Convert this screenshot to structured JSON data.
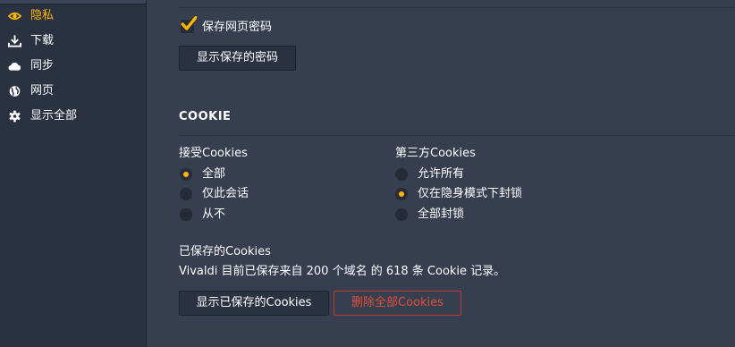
{
  "sidebar": {
    "items": [
      {
        "label": "隐私",
        "icon": "eye-icon",
        "active": true
      },
      {
        "label": "下载",
        "icon": "download-icon",
        "active": false
      },
      {
        "label": "同步",
        "icon": "cloud-icon",
        "active": false
      },
      {
        "label": "网页",
        "icon": "globe-icon",
        "active": false
      },
      {
        "label": "显示全部",
        "icon": "gear-icon",
        "active": false
      }
    ]
  },
  "passwords": {
    "save_checkbox_label": "保存网页密码",
    "save_checked": true,
    "show_saved_button": "显示保存的密码"
  },
  "cookies": {
    "heading": "COOKIE",
    "accept": {
      "label": "接受Cookies",
      "options": [
        "全部",
        "仅此会话",
        "从不"
      ],
      "selected": "全部"
    },
    "third_party": {
      "label": "第三方Cookies",
      "options": [
        "允许所有",
        "仅在隐身模式下封锁",
        "全部封锁"
      ],
      "selected": "仅在隐身模式下封锁"
    },
    "saved": {
      "label": "已保存的Cookies",
      "summary": "Vivaldi 目前已保存来自 200 个域名 的 618 条 Cookie 记录。",
      "show_button": "显示已保存的Cookies",
      "delete_button": "删除全部Cookies"
    }
  },
  "colors": {
    "accent": "#ffb700",
    "danger": "#e0503a",
    "background": "#363e4f",
    "sidebar": "#2a3140"
  }
}
